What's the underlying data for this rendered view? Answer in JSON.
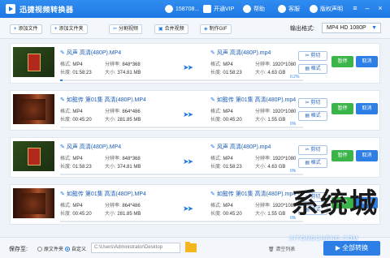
{
  "app": {
    "title": "迅捷视频转换器",
    "user": "158708...",
    "vip": "开通VIP",
    "help": "帮助",
    "support": "客服",
    "copyright": "版权声明"
  },
  "toolbar": {
    "add_file": "添加文件",
    "add_folder": "添加文件夹",
    "split_video": "分割视频",
    "merge_video": "合并视频",
    "make_gif": "制作GIF",
    "format_label": "输出格式:",
    "format_value": "MP4 HD 1080P"
  },
  "labels": {
    "format": "格式:",
    "resolution": "分辨率:",
    "duration": "长度:",
    "size": "大小:",
    "cut": "剪切",
    "fmt": "格式",
    "pause": "暂停",
    "cancel": "取消"
  },
  "files": [
    {
      "src_name": "风声 高清(480P).MP4",
      "src_format": "MP4",
      "src_res": "848*368",
      "src_dur": "01:58:23",
      "src_size": "374.81 MB",
      "dst_name": "风声 高清(480P).mp4",
      "dst_format": "MP4",
      "dst_res": "1920*1080",
      "dst_dur": "01:58:23",
      "dst_size": "4.63 GB",
      "progress_label": "0.2%",
      "progress": 0.002,
      "thumb": "green"
    },
    {
      "src_name": "如懿传 第01集 高清(480P).MP4",
      "src_format": "MP4",
      "src_res": "864*486",
      "src_dur": "00:45:20",
      "src_size": "281.85 MB",
      "dst_name": "如懿传 第01集 高清(480P).mp4",
      "dst_format": "MP4",
      "dst_res": "1920*1080",
      "dst_dur": "00:45:20",
      "dst_size": "1.55 GB",
      "progress_label": "0%",
      "progress": 0,
      "thumb": "red"
    },
    {
      "src_name": "风声 高清(480P).MP4",
      "src_format": "MP4",
      "src_res": "848*368",
      "src_dur": "01:58:23",
      "src_size": "374.81 MB",
      "dst_name": "风声 高清(480P).mp4",
      "dst_format": "MP4",
      "dst_res": "1920*1080",
      "dst_dur": "01:58:23",
      "dst_size": "4.63 GB",
      "progress_label": "0%",
      "progress": 0,
      "thumb": "green"
    },
    {
      "src_name": "如懿传 第01集 高清(480P).MP4",
      "src_format": "MP4",
      "src_res": "864*486",
      "src_dur": "00:45:20",
      "src_size": "281.85 MB",
      "dst_name": "如懿传 第01集 高清(480P).mp4",
      "dst_format": "MP4",
      "dst_res": "1920*1080",
      "dst_dur": "00:45:20",
      "dst_size": "1.55 GB",
      "progress_label": "0%",
      "progress": 0,
      "thumb": "red"
    }
  ],
  "bottom": {
    "save_label": "保存至:",
    "opt_source": "原文件夹",
    "opt_custom": "自定义",
    "path": "C:\\Users\\Administrator\\Desktop",
    "clear": "清空列表",
    "start": "全部转换"
  },
  "watermark": {
    "text": "系统城",
    "sub": "XITONGCHENG.COM"
  },
  "colors": {
    "primary": "#2d7fe6",
    "pause": "#3bb449",
    "title_bar": "#1e78e4"
  }
}
